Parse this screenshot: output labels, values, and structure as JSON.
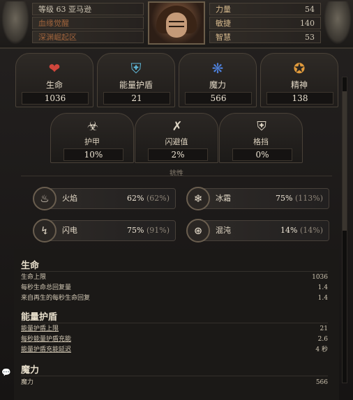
{
  "header": {
    "level_line": "等级 63 亚马逊",
    "line2": "血缘觉醒",
    "line3": "深渊崛起区",
    "attributes": [
      {
        "label": "力量",
        "value": "54"
      },
      {
        "label": "敏捷",
        "value": "140"
      },
      {
        "label": "智慧",
        "value": "53"
      }
    ]
  },
  "primary_stats": [
    {
      "label": "生命",
      "value": "1036",
      "icon": "heart-icon"
    },
    {
      "label": "能量护盾",
      "value": "21",
      "icon": "shield-icon"
    },
    {
      "label": "魔力",
      "value": "566",
      "icon": "mana-flask-icon"
    },
    {
      "label": "精神",
      "value": "138",
      "icon": "spirit-icon"
    }
  ],
  "secondary_stats": [
    {
      "label": "护甲",
      "value": "10%",
      "icon": "armor-icon"
    },
    {
      "label": "闪避值",
      "value": "2%",
      "icon": "evasion-icon"
    },
    {
      "label": "格挡",
      "value": "0%",
      "icon": "block-shield-icon"
    }
  ],
  "resist_title": "抗性",
  "resistances": [
    {
      "label": "火焰",
      "value": "62%",
      "max": "(62%)",
      "icon": "fire-icon"
    },
    {
      "label": "冰霜",
      "value": "75%",
      "max": "(113%)",
      "icon": "cold-icon"
    },
    {
      "label": "闪电",
      "value": "75%",
      "max": "(91%)",
      "icon": "lightning-icon"
    },
    {
      "label": "混沌",
      "value": "14%",
      "max": "(14%)",
      "icon": "chaos-icon"
    }
  ],
  "details": {
    "life": {
      "title": "生命",
      "rows": [
        {
          "label": "生命上限",
          "value": "1036"
        },
        {
          "label": "每秒生命总回复量",
          "value": "1.4"
        },
        {
          "label": "来自再生的每秒生命回复",
          "value": "1.4"
        }
      ]
    },
    "energy_shield": {
      "title": "能量护盾",
      "rows": [
        {
          "label": "能量护盾上限",
          "value": "21"
        },
        {
          "label": "每秒能量护盾充能",
          "value": "2.6"
        },
        {
          "label": "能量护盾充能延迟",
          "value": "4 秒"
        }
      ]
    },
    "mana": {
      "title": "魔力",
      "rows": [
        {
          "label": "魔力",
          "value": "566"
        }
      ]
    }
  },
  "colors": {
    "accent": "#d6b98d",
    "background": "#1a1816",
    "faded_text": "#a0643c"
  }
}
